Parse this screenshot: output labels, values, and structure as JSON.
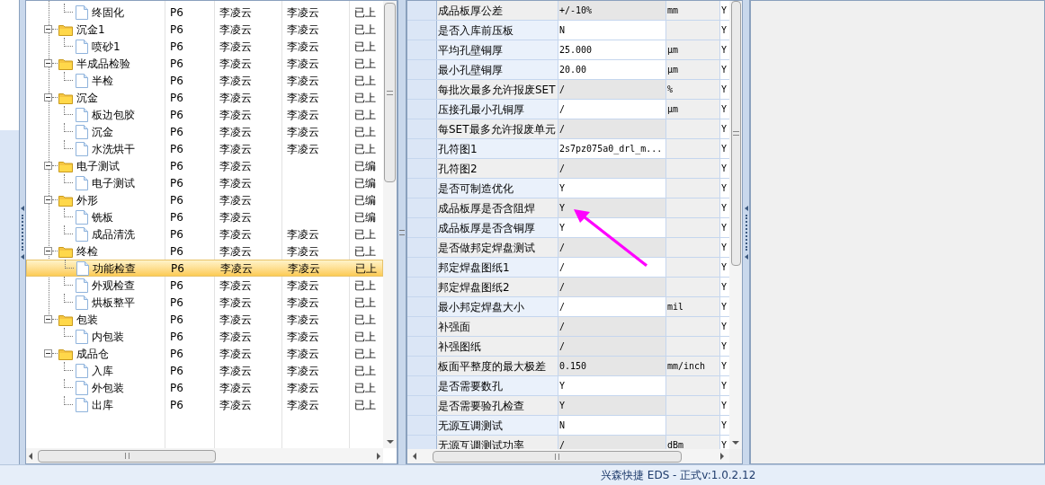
{
  "tree": {
    "rows": [
      {
        "kind": "file",
        "label": "终固化",
        "code": "P6",
        "creator": "李凌云",
        "reviewer": "李凌云",
        "status": "已上",
        "selected": false
      },
      {
        "kind": "folder",
        "label": "沉金1",
        "code": "P6",
        "creator": "李凌云",
        "reviewer": "李凌云",
        "status": "已上",
        "selected": false,
        "expanded": true,
        "children": [
          {
            "kind": "file",
            "label": "喷砂1",
            "code": "P6",
            "creator": "李凌云",
            "reviewer": "李凌云",
            "status": "已上",
            "selected": false
          }
        ]
      },
      {
        "kind": "folder",
        "label": "半成品检验",
        "code": "P6",
        "creator": "李凌云",
        "reviewer": "李凌云",
        "status": "已上",
        "selected": false,
        "expanded": true,
        "children": [
          {
            "kind": "file",
            "label": "半检",
            "code": "P6",
            "creator": "李凌云",
            "reviewer": "李凌云",
            "status": "已上",
            "selected": false
          }
        ]
      },
      {
        "kind": "folder",
        "label": "沉金",
        "code": "P6",
        "creator": "李凌云",
        "reviewer": "李凌云",
        "status": "已上",
        "selected": false,
        "expanded": true,
        "children": [
          {
            "kind": "file",
            "label": "板边包胶",
            "code": "P6",
            "creator": "李凌云",
            "reviewer": "李凌云",
            "status": "已上",
            "selected": false
          },
          {
            "kind": "file",
            "label": "沉金",
            "code": "P6",
            "creator": "李凌云",
            "reviewer": "李凌云",
            "status": "已上",
            "selected": false
          },
          {
            "kind": "file",
            "label": "水洗烘干",
            "code": "P6",
            "creator": "李凌云",
            "reviewer": "李凌云",
            "status": "已上",
            "selected": false
          }
        ]
      },
      {
        "kind": "folder",
        "label": "电子测试",
        "code": "P6",
        "creator": "李凌云",
        "status": "已编",
        "selected": false,
        "expanded": true,
        "children": [
          {
            "kind": "file",
            "label": "电子测试",
            "code": "P6",
            "creator": "李凌云",
            "status": "已编",
            "selected": false
          }
        ]
      },
      {
        "kind": "folder",
        "label": "外形",
        "code": "P6",
        "creator": "李凌云",
        "status": "已编",
        "selected": false,
        "expanded": true,
        "children": [
          {
            "kind": "file",
            "label": "铣板",
            "code": "P6",
            "creator": "李凌云",
            "status": "已编",
            "selected": false
          },
          {
            "kind": "file",
            "label": "成品清洗",
            "code": "P6",
            "creator": "李凌云",
            "reviewer": "李凌云",
            "status": "已上",
            "selected": false
          }
        ]
      },
      {
        "kind": "folder",
        "label": "终检",
        "code": "P6",
        "creator": "李凌云",
        "reviewer": "李凌云",
        "status": "已上",
        "selected": false,
        "expanded": true,
        "children": [
          {
            "kind": "file",
            "label": "功能检查",
            "code": "P6",
            "creator": "李凌云",
            "reviewer": "李凌云",
            "status": "已上",
            "selected": true
          },
          {
            "kind": "file",
            "label": "外观检查",
            "code": "P6",
            "creator": "李凌云",
            "reviewer": "李凌云",
            "status": "已上",
            "selected": false
          },
          {
            "kind": "file",
            "label": "烘板整平",
            "code": "P6",
            "creator": "李凌云",
            "reviewer": "李凌云",
            "status": "已上",
            "selected": false
          }
        ]
      },
      {
        "kind": "folder",
        "label": "包装",
        "code": "P6",
        "creator": "李凌云",
        "reviewer": "李凌云",
        "status": "已上",
        "selected": false,
        "expanded": true,
        "children": [
          {
            "kind": "file",
            "label": "内包装",
            "code": "P6",
            "creator": "李凌云",
            "reviewer": "李凌云",
            "status": "已上",
            "selected": false
          }
        ]
      },
      {
        "kind": "folder",
        "label": "成品仓",
        "code": "P6",
        "creator": "李凌云",
        "reviewer": "李凌云",
        "status": "已上",
        "selected": false,
        "expanded": true,
        "children": [
          {
            "kind": "file",
            "label": "入库",
            "code": "P6",
            "creator": "李凌云",
            "reviewer": "李凌云",
            "status": "已上",
            "selected": false
          },
          {
            "kind": "file",
            "label": "外包装",
            "code": "P6",
            "creator": "李凌云",
            "reviewer": "李凌云",
            "status": "已上",
            "selected": false
          },
          {
            "kind": "file",
            "label": "出库",
            "code": "P6",
            "creator": "李凌云",
            "reviewer": "李凌云",
            "status": "已上",
            "selected": false
          }
        ]
      }
    ]
  },
  "properties": {
    "rows": [
      {
        "name": "成品板厚公差",
        "value": "+/-10%",
        "unit": "mm",
        "flag": "Y",
        "editable": false
      },
      {
        "name": "是否入库前压板",
        "value": "N",
        "flag": "Y",
        "editable": true
      },
      {
        "name": "平均孔壁铜厚",
        "value": "25.000",
        "unit": "μm",
        "flag": "Y",
        "editable": true
      },
      {
        "name": "最小孔壁铜厚",
        "value": "20.00",
        "unit": "μm",
        "flag": "Y",
        "editable": true
      },
      {
        "name": "每批次最多允许报废SET",
        "value": "/",
        "unit": "%",
        "flag": "Y",
        "editable": false
      },
      {
        "name": "压接孔最小孔铜厚",
        "value": "/",
        "unit": "μm",
        "flag": "Y",
        "editable": true
      },
      {
        "name": "每SET最多允许报废单元",
        "value": "/",
        "flag": "Y",
        "editable": false
      },
      {
        "name": "孔符图1",
        "value": "2s7pz075a0_drl_m...",
        "flag": "Y",
        "editable": true
      },
      {
        "name": "孔符图2",
        "value": "/",
        "flag": "Y",
        "editable": false
      },
      {
        "name": "是否可制造优化",
        "value": "Y",
        "flag": "Y",
        "editable": true
      },
      {
        "name": "成品板厚是否含阻焊",
        "value": "Y",
        "flag": "Y",
        "editable": false
      },
      {
        "name": "成品板厚是否含铜厚",
        "value": "Y",
        "flag": "Y",
        "editable": true
      },
      {
        "name": "是否做邦定焊盘测试",
        "value": "/",
        "flag": "Y",
        "editable": false
      },
      {
        "name": "邦定焊盘图纸1",
        "value": "/",
        "flag": "Y",
        "editable": true
      },
      {
        "name": "邦定焊盘图纸2",
        "value": "/",
        "flag": "Y",
        "editable": false
      },
      {
        "name": "最小邦定焊盘大小",
        "value": "/",
        "unit": "mil",
        "flag": "Y",
        "editable": true
      },
      {
        "name": "补强面",
        "value": "/",
        "flag": "Y",
        "editable": false
      },
      {
        "name": "补强图纸",
        "value": "/",
        "flag": "Y",
        "editable": false
      },
      {
        "name": "板面平整度的最大极差",
        "value": "0.150",
        "unit": "mm/inch",
        "flag": "Y",
        "editable": false
      },
      {
        "name": "是否需要数孔",
        "value": "Y",
        "flag": "Y",
        "editable": true
      },
      {
        "name": "是否需要验孔检查",
        "value": "Y",
        "flag": "Y",
        "editable": false
      },
      {
        "name": "无源互调测试",
        "value": "N",
        "flag": "Y",
        "editable": true
      },
      {
        "name": "无源互调测试功率",
        "value": "/",
        "unit": "dBm",
        "flag": "Y",
        "editable": false
      }
    ]
  },
  "status_bar": {
    "text": "兴森快捷 EDS - 正式v:1.0.2.12"
  }
}
